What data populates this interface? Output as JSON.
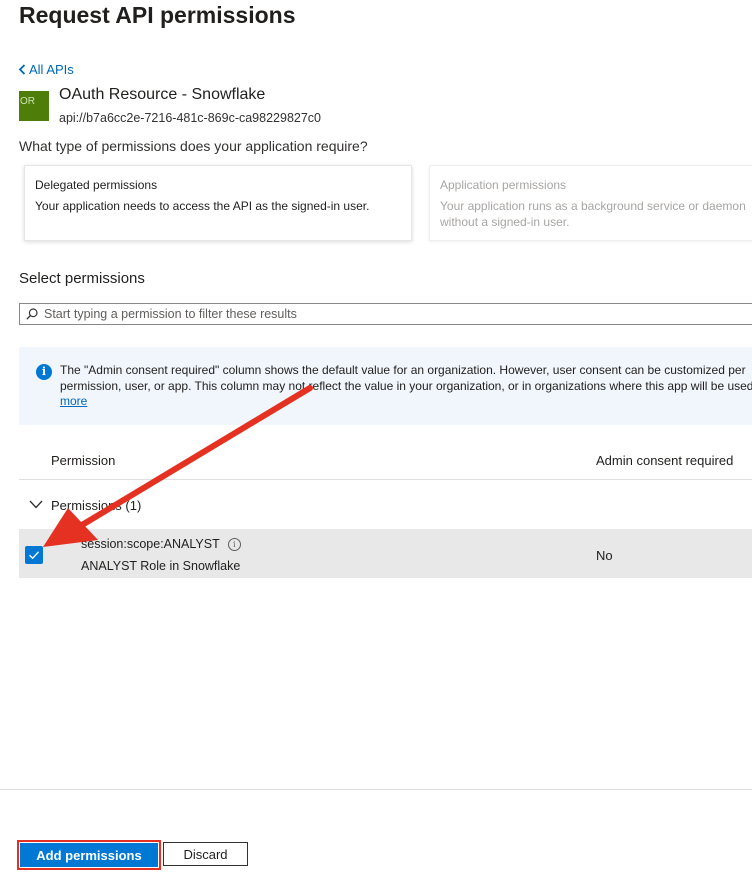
{
  "page": {
    "title": "Request API permissions"
  },
  "nav": {
    "back_label": "All APIs"
  },
  "api": {
    "logo_initials": "OR",
    "logo_color": "#4f7d0a",
    "name": "OAuth Resource - Snowflake",
    "id": "api://b7a6cc2e-7216-481c-869c-ca98229827c0"
  },
  "permission_type": {
    "question": "What type of permissions does your application require?",
    "delegated": {
      "title": "Delegated permissions",
      "description": "Your application needs to access the API as the signed-in user."
    },
    "application": {
      "title": "Application permissions",
      "description": "Your application runs as a background service or daemon without a signed-in user."
    }
  },
  "select": {
    "heading": "Select permissions",
    "search_placeholder": "Start typing a permission to filter these results"
  },
  "notice": {
    "text": "The \"Admin consent required\" column shows the default value for an organization. However, user consent can be customized per permission, user, or app. This column may not reflect the value in your organization, or in organizations where this app will be used.",
    "link": "more"
  },
  "table": {
    "columns": [
      "Permission",
      "Admin consent required"
    ],
    "group_label": "Permissions (1)",
    "rows": [
      {
        "name": "session:scope:ANALYST",
        "description": "ANALYST Role in Snowflake",
        "admin_consent": "No",
        "checked": true
      }
    ]
  },
  "footer": {
    "add_label": "Add permissions",
    "discard_label": "Discard"
  },
  "colors": {
    "accent": "#0078d4",
    "link": "#0067b8",
    "annotation": "#e53122"
  }
}
